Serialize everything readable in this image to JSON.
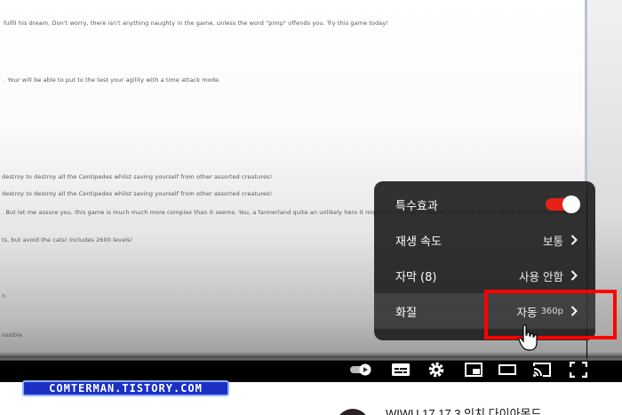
{
  "video_page_text": [
    "fulfil his dream. Don't worry, there isn't anything naughty in the game, unless the word \"pimp\" offends you. Try this game today!",
    ". Your will be able to put to the test your agility with a time attack mode.",
    "destroy to destroy all the Centipedes whilst saving yourself from other assorted creatures!",
    "destroy to destroy all the Centipedes whilst saving yourself from other assorted creatures!",
    ". But let me assure you, this game is much much more complex than it seems. You, a farmerland quite an unlikely hero it might be, so that is exactly what the wizard Oliver Ron is used to do the resolve",
    "ts, but avoid the cats! Includes 2600 levels!",
    "n",
    "ossible"
  ],
  "settings_menu": {
    "items": [
      {
        "label": "특수효과",
        "type": "toggle",
        "on": true
      },
      {
        "label": "재생 속도",
        "value": "보통"
      },
      {
        "label": "자막 (8)",
        "value": "사용 안함"
      },
      {
        "label": "화질",
        "value": "자동",
        "sub": "360p"
      }
    ]
  },
  "controls": {
    "icons": [
      "autoplay-toggle-icon",
      "subtitles-icon",
      "settings-gear-icon",
      "miniplayer-icon",
      "theater-mode-icon",
      "cast-icon",
      "fullscreen-icon"
    ]
  },
  "watermark": "COMTERMAN.TISTORY.COM",
  "related": {
    "title": "WIWU 17.17.3 인치 다이아몬드"
  },
  "colors": {
    "accent_red": "#e62117",
    "highlight": "#ff0000",
    "watermark_bg": "#1c2fc4"
  }
}
